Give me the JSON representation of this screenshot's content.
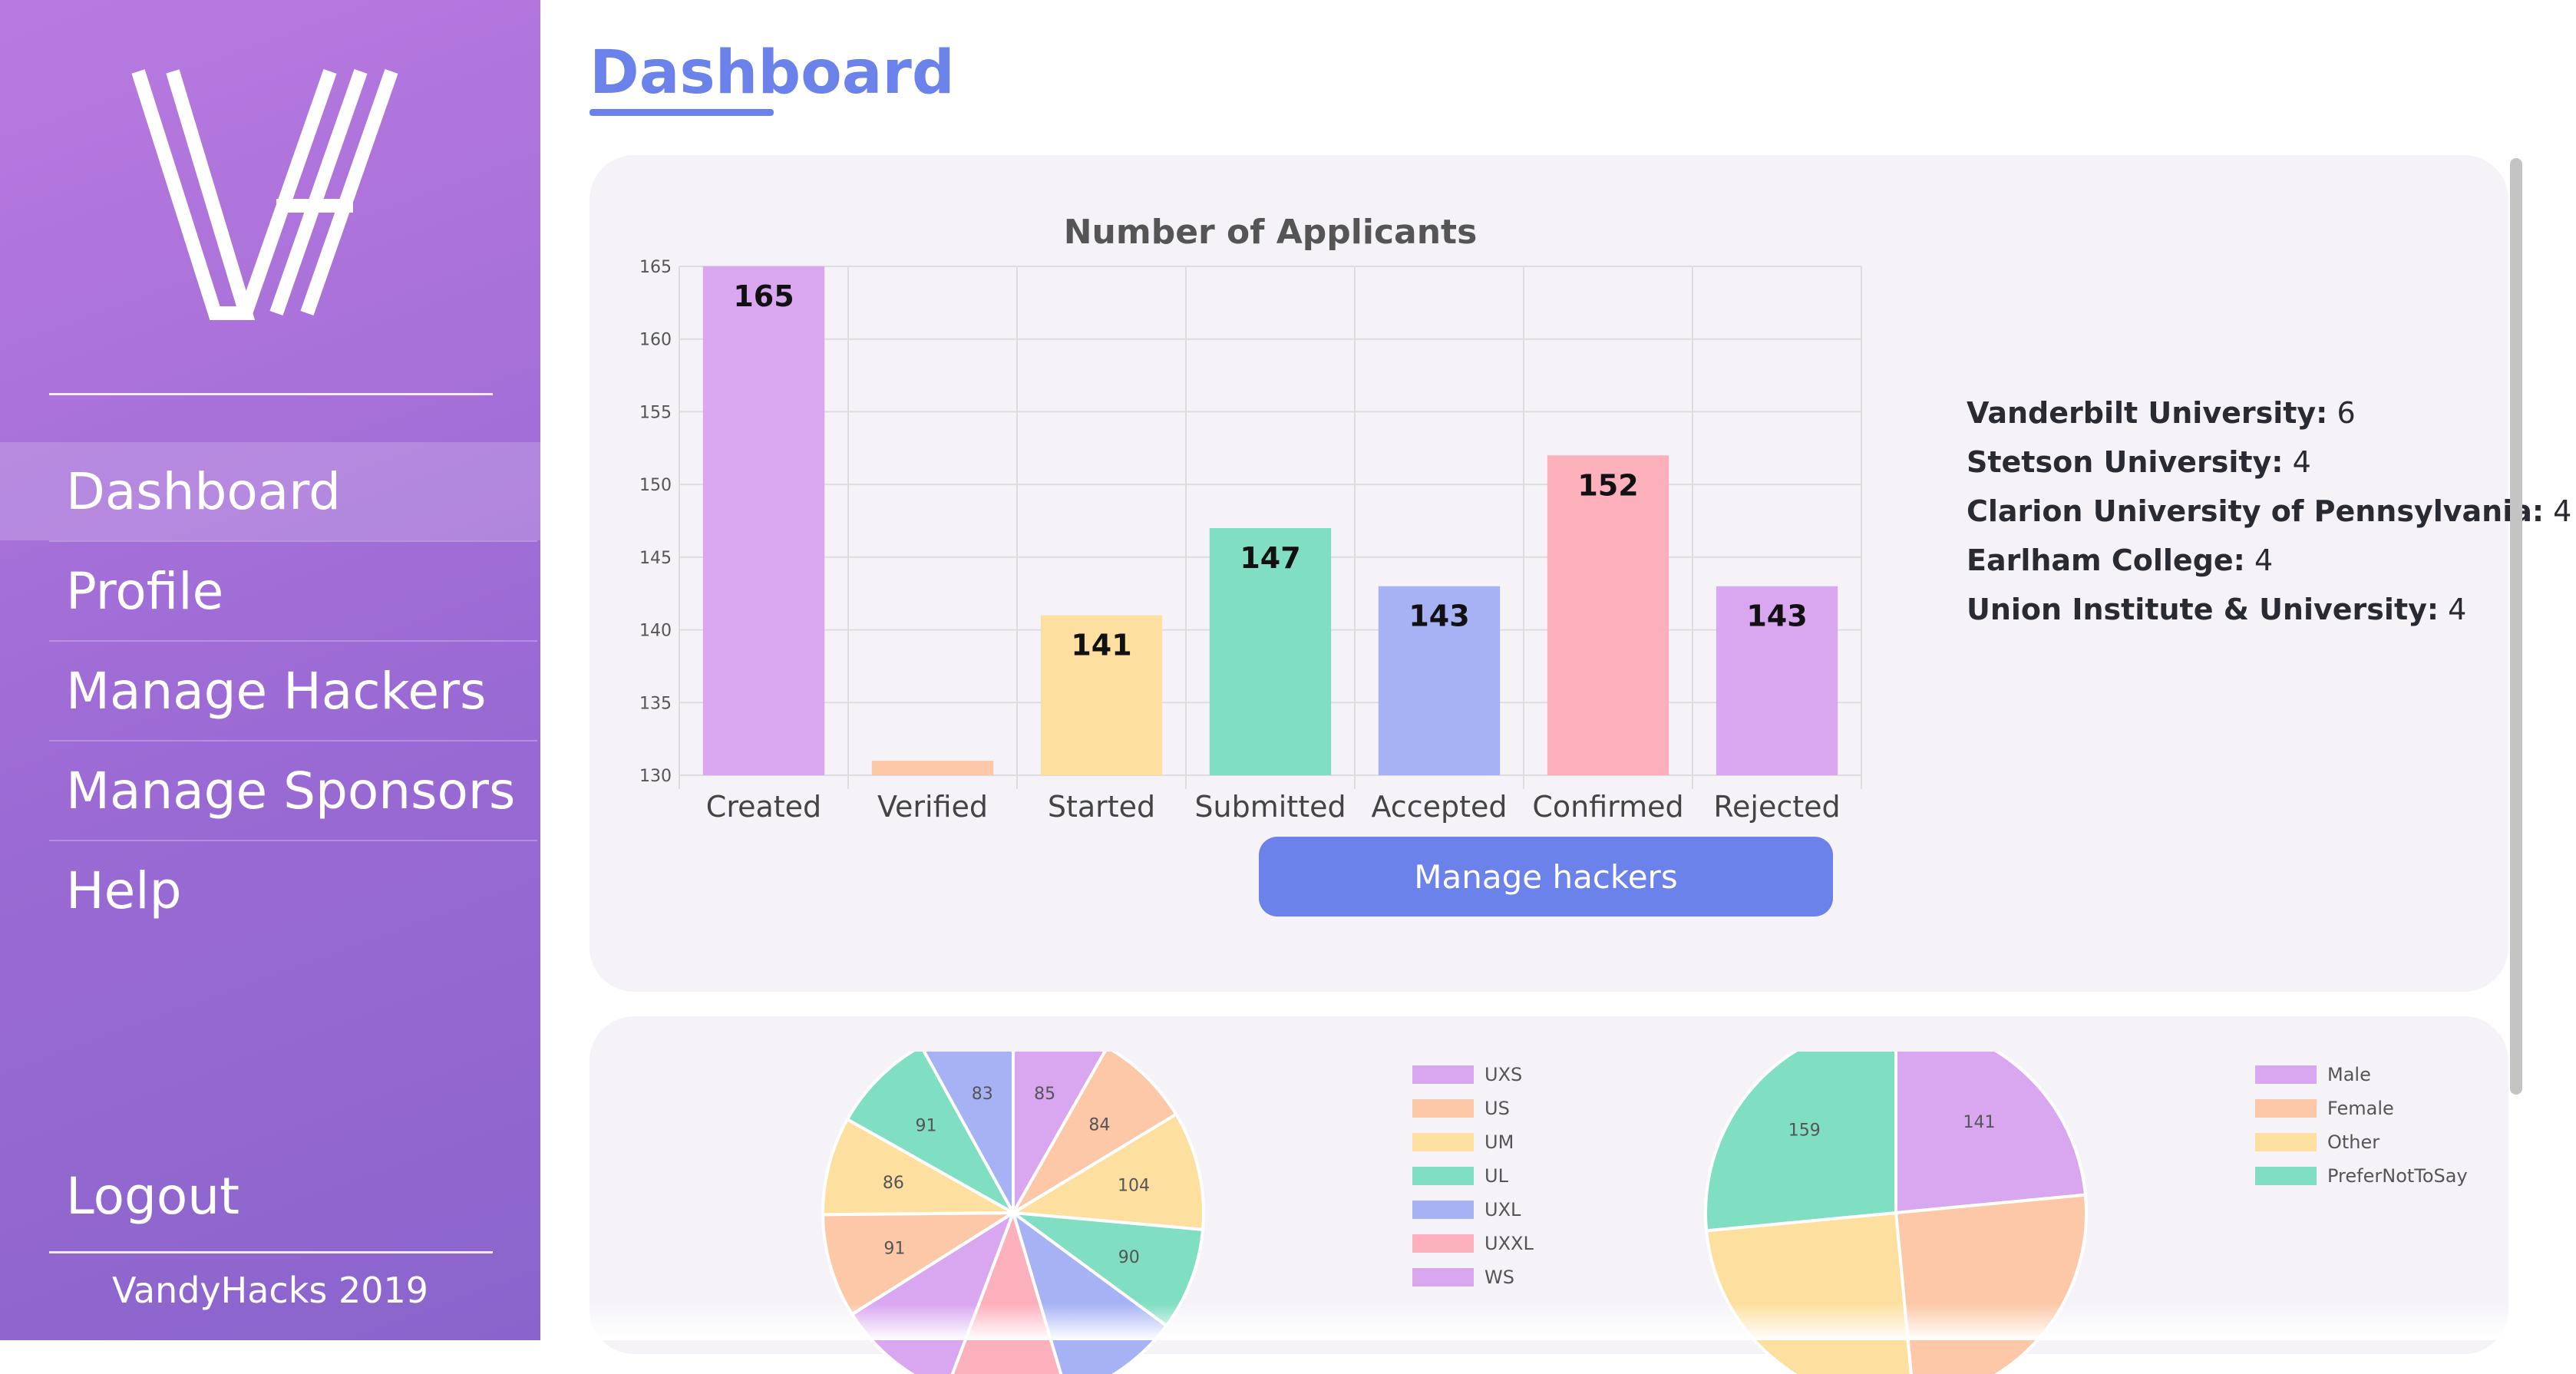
{
  "sidebar": {
    "nav": [
      {
        "label": "Dashboard",
        "active": true
      },
      {
        "label": "Profile"
      },
      {
        "label": "Manage Hackers"
      },
      {
        "label": "Manage Sponsors"
      },
      {
        "label": "Help"
      }
    ],
    "logout_label": "Logout",
    "footer": "VandyHacks 2019"
  },
  "page": {
    "title": "Dashboard"
  },
  "chart_data": [
    {
      "type": "bar",
      "title": "Number of Applicants",
      "categories": [
        "Created",
        "Verified",
        "Started",
        "Submitted",
        "Accepted",
        "Confirmed",
        "Rejected"
      ],
      "values": [
        165,
        131,
        141,
        147,
        143,
        152,
        143
      ],
      "data_labels": [
        "165",
        "",
        "141",
        "147",
        "143",
        "152",
        "143"
      ],
      "colors": [
        "#d9a6f0",
        "#fcc8a8",
        "#fde0a0",
        "#80dec2",
        "#a7b2f5",
        "#fcb0bc",
        "#d9a6f0"
      ],
      "ylim": [
        130,
        165
      ],
      "yticks": [
        130,
        135,
        140,
        145,
        150,
        155,
        160,
        165
      ],
      "grid": true
    },
    {
      "type": "pie",
      "labels": [
        "UXS",
        "US",
        "UM",
        "UL",
        "UXL",
        "UXXL",
        "WS"
      ],
      "legend_labels": [
        "UXS",
        "US",
        "UM",
        "UL",
        "UXL",
        "UXXL",
        "WS"
      ],
      "visible_values": [
        {
          "value": 85,
          "color": "#d9a6f0"
        },
        {
          "value": 84,
          "color": "#fcc8a8"
        },
        {
          "value": 104,
          "color": "#fde0a0"
        },
        {
          "value": 90,
          "color": "#80dec2"
        },
        {
          "value": null,
          "color": "#a7b2f5"
        },
        {
          "value": null,
          "color": "#fcb0bc"
        },
        {
          "value": null,
          "color": "#d9a6f0"
        },
        {
          "value": 91,
          "color": "#fcc8a8"
        },
        {
          "value": 86,
          "color": "#fde0a0"
        },
        {
          "value": 91,
          "color": "#80dec2"
        },
        {
          "value": 83,
          "color": "#a7b2f5"
        }
      ],
      "legend_colors": [
        "#d9a6f0",
        "#fcc8a8",
        "#fde0a0",
        "#80dec2",
        "#a7b2f5",
        "#fcb0bc",
        "#d9a6f0"
      ],
      "legend_placement": "right"
    },
    {
      "type": "pie",
      "labels": [
        "Male",
        "Female",
        "Other",
        "PreferNotToSay"
      ],
      "legend_labels": [
        "Male",
        "Female",
        "Other",
        "PreferNotToSay"
      ],
      "visible_values": [
        {
          "value": 141,
          "color": "#d9a6f0"
        },
        {
          "value": null,
          "color": "#fcc8a8"
        },
        {
          "value": null,
          "color": "#fde0a0"
        },
        {
          "value": 159,
          "color": "#80dec2"
        }
      ],
      "legend_colors": [
        "#d9a6f0",
        "#fcc8a8",
        "#fde0a0",
        "#80dec2"
      ],
      "legend_placement": "right"
    }
  ],
  "universities": [
    {
      "name": "Vanderbilt University:",
      "count": "6"
    },
    {
      "name": "Stetson University:",
      "count": "4"
    },
    {
      "name": "Clarion University of Pennsylvania:",
      "count": "4"
    },
    {
      "name": "Earlham College:",
      "count": "4"
    },
    {
      "name": "Union Institute & University:",
      "count": "4"
    }
  ],
  "manage_button_label": "Manage hackers",
  "colors": {
    "accent": "#6b82ea",
    "sidebar_top": "#b97ae0",
    "sidebar_bottom": "#8a64cc"
  }
}
